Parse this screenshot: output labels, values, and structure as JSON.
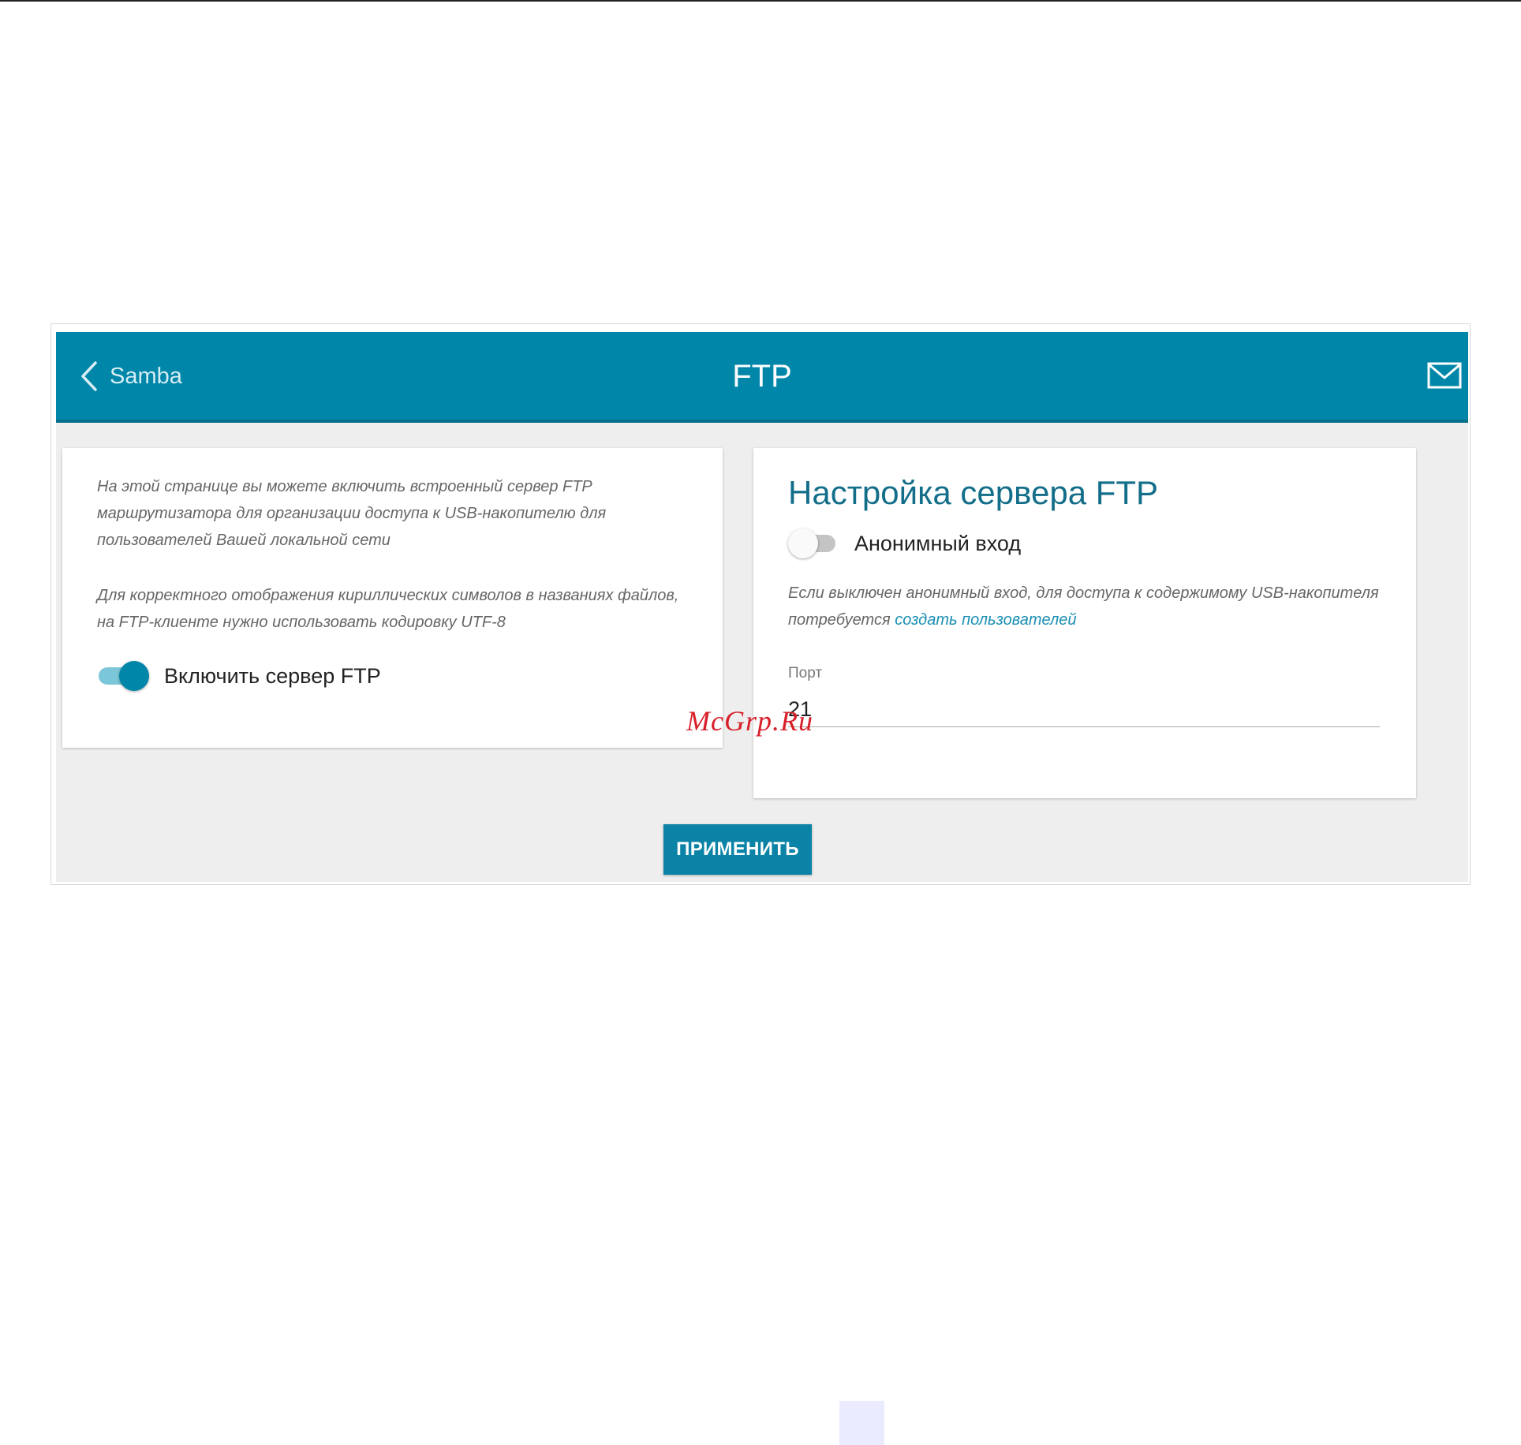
{
  "header": {
    "back_label": "Samba",
    "title": "FTP"
  },
  "info": {
    "paragraph_1": "На этой странице вы можете включить встроенный сервер FTP маршрутизатора для организации доступа к USB-накопителю для пользователей Вашей локальной сети",
    "paragraph_2": "Для корректного отображения кириллических символов в названиях файлов, на FTP-клиенте нужно использовать кодировку UTF-8"
  },
  "enable_ftp": {
    "label": "Включить сервер FTP",
    "state": "on"
  },
  "settings": {
    "title": "Настройка сервера FTP",
    "anonymous_label": "Анонимный вход",
    "anonymous_state": "off",
    "anonymous_note": "Если выключен анонимный вход, для доступа к содержимому USB-накопителя потребуется",
    "create_users_link": "создать пользователей",
    "port_label": "Порт",
    "port_value": "21"
  },
  "apply_label": "ПРИМЕНИТЬ",
  "watermark": "McGrp.Ru",
  "colors": {
    "accent": "#0086a9",
    "title": "#136e8a",
    "link": "#1b8fb3",
    "background": "#eeeeee",
    "watermark": "#d8202a"
  },
  "icons": [
    "chevron-left-icon",
    "mail-icon"
  ]
}
